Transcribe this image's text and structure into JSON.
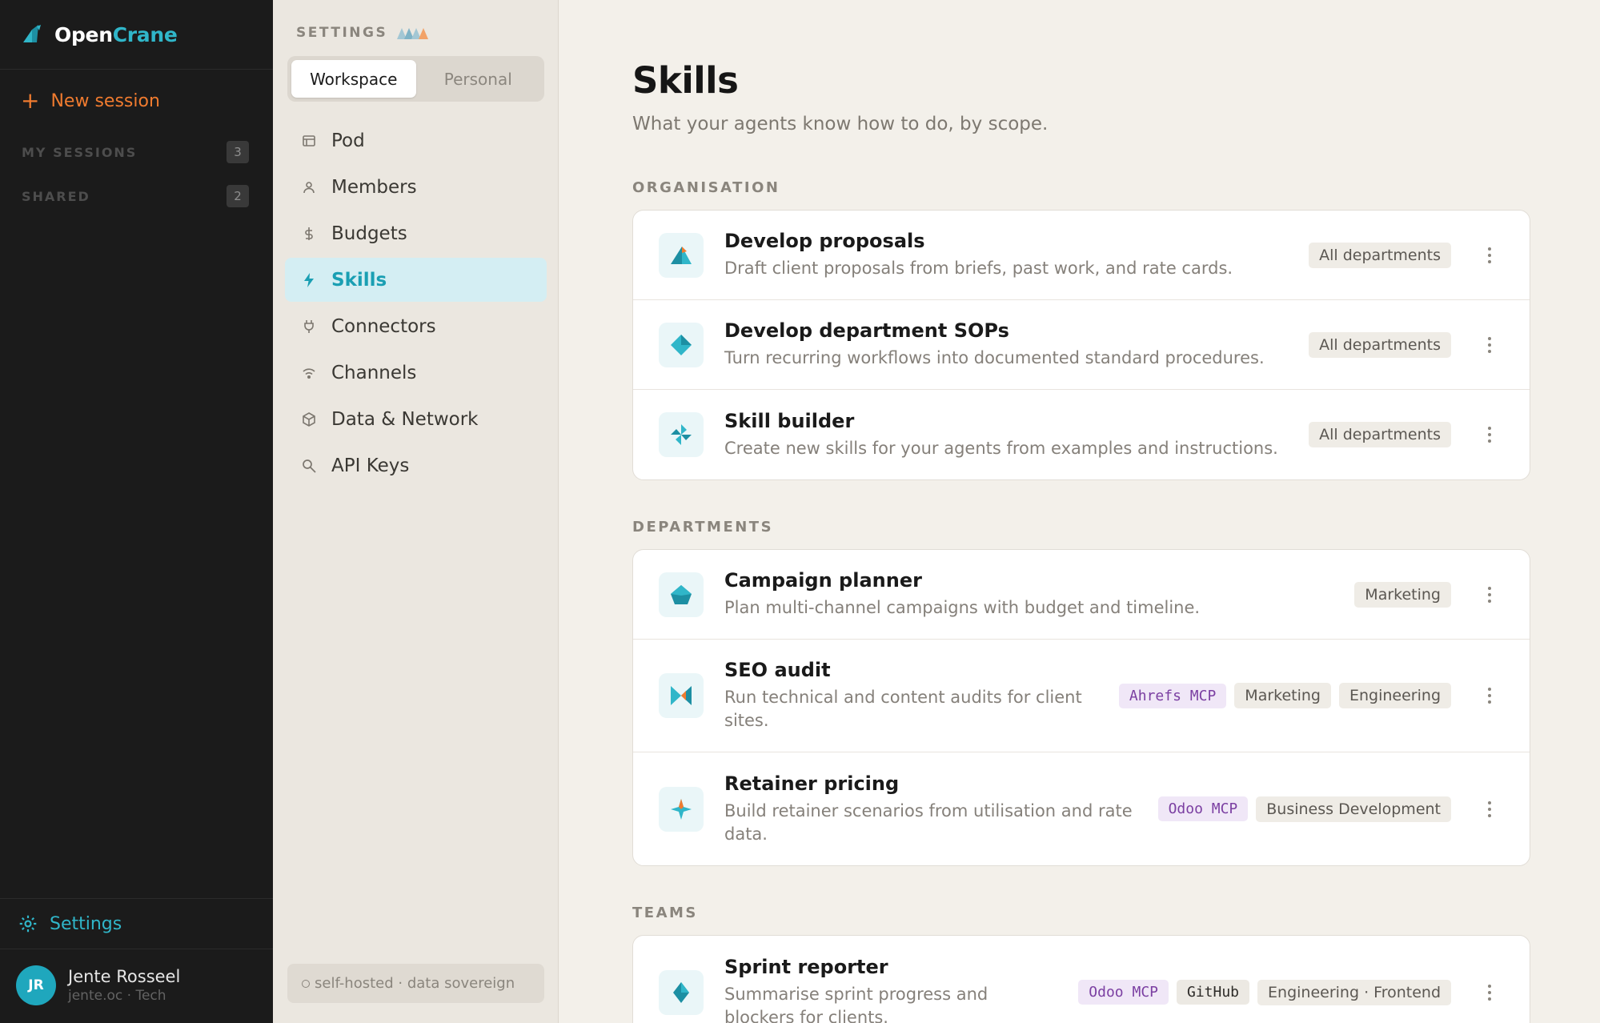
{
  "brand": {
    "name_part1": "Open",
    "name_part2": "Crane"
  },
  "sidebar": {
    "new_session": "New session",
    "sections": [
      {
        "name": "MY SESSIONS",
        "count": "3"
      },
      {
        "name": "SHARED",
        "count": "2"
      }
    ],
    "settings_label": "Settings",
    "user": {
      "initials": "JR",
      "name": "Jente Rosseel",
      "subtitle": "jente.oc · Tech"
    }
  },
  "settings_panel": {
    "heading": "SETTINGS",
    "toggle": {
      "options": [
        "Workspace",
        "Personal"
      ],
      "active": "Workspace"
    },
    "nav": [
      {
        "label": "Pod",
        "icon": "pod-icon"
      },
      {
        "label": "Members",
        "icon": "person-icon"
      },
      {
        "label": "Budgets",
        "icon": "budget-icon"
      },
      {
        "label": "Skills",
        "icon": "lightning-icon",
        "active": true
      },
      {
        "label": "Connectors",
        "icon": "plug-icon"
      },
      {
        "label": "Channels",
        "icon": "wifi-icon"
      },
      {
        "label": "Data & Network",
        "icon": "cube-icon"
      },
      {
        "label": "API Keys",
        "icon": "key-icon"
      }
    ],
    "footer": "self-hosted · data sovereign"
  },
  "page": {
    "title": "Skills",
    "subtitle": "What your agents know how to do, by scope."
  },
  "groups": [
    {
      "label": "ORGANISATION",
      "skills": [
        {
          "name": "Develop proposals",
          "description": "Draft client proposals from briefs, past work, and rate cards.",
          "icon": "mountain-icon",
          "tags": [
            {
              "text": "All departments",
              "kind": "scope"
            }
          ]
        },
        {
          "name": "Develop department SOPs",
          "description": "Turn recurring workflows into documented standard procedures.",
          "icon": "diamond-icon",
          "tags": [
            {
              "text": "All departments",
              "kind": "scope"
            }
          ]
        },
        {
          "name": "Skill builder",
          "description": "Create new skills for your agents from examples and instructions.",
          "icon": "pinwheel-icon",
          "tags": [
            {
              "text": "All departments",
              "kind": "scope"
            }
          ]
        }
      ]
    },
    {
      "label": "DEPARTMENTS",
      "skills": [
        {
          "name": "Campaign planner",
          "description": "Plan multi-channel campaigns with budget and timeline.",
          "icon": "pentagon-icon",
          "tags": [
            {
              "text": "Marketing",
              "kind": "scope"
            }
          ]
        },
        {
          "name": "SEO audit",
          "description": "Run technical and content audits for client sites.",
          "icon": "bowtie-icon",
          "tags": [
            {
              "text": "Ahrefs MCP",
              "kind": "mcp"
            },
            {
              "text": "Marketing",
              "kind": "scope"
            },
            {
              "text": "Engineering",
              "kind": "scope"
            }
          ]
        },
        {
          "name": "Retainer pricing",
          "description": "Build retainer scenarios from utilisation and rate data.",
          "icon": "sparkle-icon",
          "tags": [
            {
              "text": "Odoo MCP",
              "kind": "mcp"
            },
            {
              "text": "Business Development",
              "kind": "scope"
            }
          ]
        }
      ]
    },
    {
      "label": "TEAMS",
      "skills": [
        {
          "name": "Sprint reporter",
          "description": "Summarise sprint progress and blockers for clients.",
          "icon": "gem-icon",
          "tags": [
            {
              "text": "Odoo MCP",
              "kind": "mcp"
            },
            {
              "text": "GitHub",
              "kind": "tool"
            },
            {
              "text": "Engineering · Frontend",
              "kind": "scope"
            }
          ]
        }
      ]
    }
  ],
  "colors": {
    "accent_teal": "#1a9fb3",
    "accent_orange": "#f07b2f",
    "mcp_purple": "#7b3fa2"
  }
}
